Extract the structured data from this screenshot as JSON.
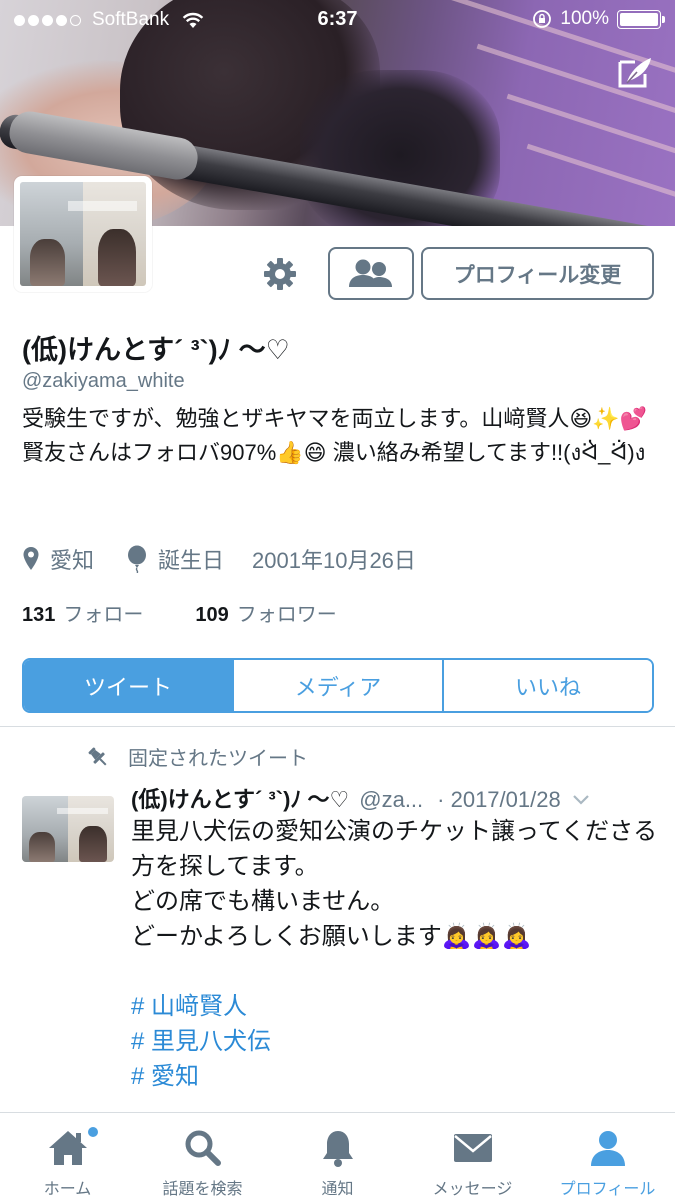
{
  "status_bar": {
    "carrier": "SoftBank",
    "time": "6:37",
    "battery": "100%"
  },
  "profile": {
    "name": "(低)けんとす´ ³`)ﾉ 〜♡",
    "handle": "@zakiyama_white",
    "bio": "受験生ですが、勉強とザキヤマを両立します。山﨑賢人😆✨💕 賢友さんはフォロバ907%👍😄 濃い絡み希望してます!!(งᐛ̀_ᐛ́)ง",
    "location": "愛知",
    "birthday_label": "誕生日",
    "birthday": "2001年10月26日",
    "following_count": "131",
    "following_label": "フォロー",
    "followers_count": "109",
    "followers_label": "フォロワー"
  },
  "buttons": {
    "edit_profile": "プロフィール変更"
  },
  "tabs": [
    {
      "label": "ツイート",
      "active": true
    },
    {
      "label": "メディア",
      "active": false
    },
    {
      "label": "いいね",
      "active": false
    }
  ],
  "pinned_tweet": {
    "pinned_label": "固定されたツイート",
    "name": "(低)けんとす´ ³`)ﾉ 〜♡",
    "handle": "@za...",
    "date": "· 2017/01/28",
    "lines": [
      "里見八犬伝の愛知公演のチケット譲ってくださる方を探してます。",
      "どの席でも構いません。",
      "どーかよろしくお願いします🙇‍♀️🙇‍♀️🙇‍♀️"
    ],
    "hashtags": [
      "# 山﨑賢人",
      "# 里見八犬伝",
      "# 愛知"
    ]
  },
  "bottom_nav": [
    {
      "label": "ホーム",
      "icon": "home-icon",
      "active": false
    },
    {
      "label": "話題を検索",
      "icon": "search-icon",
      "active": false
    },
    {
      "label": "通知",
      "icon": "bell-icon",
      "active": false
    },
    {
      "label": "メッセージ",
      "icon": "envelope-icon",
      "active": false
    },
    {
      "label": "プロフィール",
      "icon": "person-icon",
      "active": true
    }
  ],
  "colors": {
    "accent": "#4a9fe0",
    "secondary_text": "#657786",
    "primary_text": "#14171a",
    "hashtag": "#2b8ad6"
  }
}
